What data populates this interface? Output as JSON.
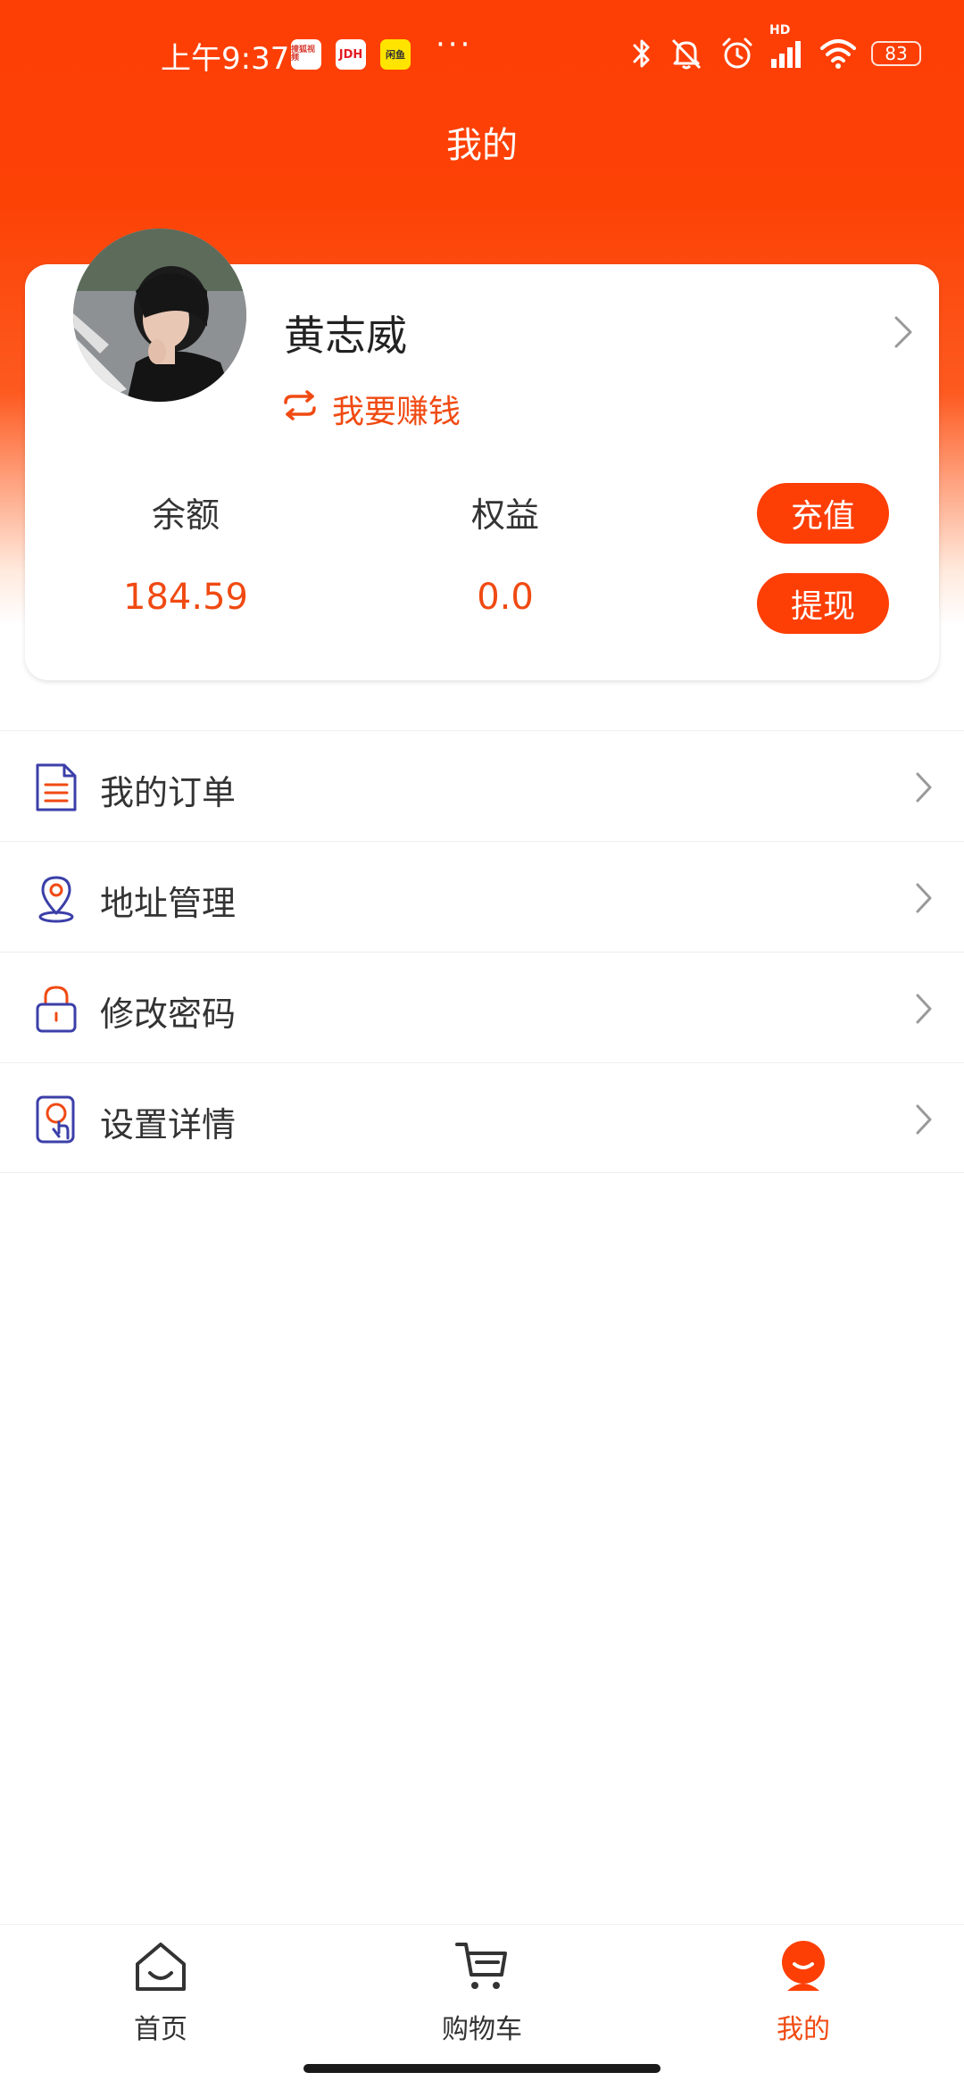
{
  "status_bar": {
    "time": "上午9:37",
    "notification_badges": [
      "搜狐视频",
      "JDH",
      "闲鱼"
    ],
    "more": "···",
    "icons": [
      "bluetooth-icon",
      "mute-icon",
      "alarm-icon",
      "signal-icon",
      "wifi-icon"
    ],
    "signal_label": "HD",
    "battery": "83"
  },
  "header": {
    "title": "我的"
  },
  "profile": {
    "name": "黄志威",
    "earn_link": "我要赚钱",
    "balance_label": "余额",
    "balance_value": "184.59",
    "equity_label": "权益",
    "equity_value": "0.0",
    "recharge_button": "充值",
    "withdraw_button": "提现"
  },
  "menu": {
    "items": [
      {
        "label": "我的订单",
        "icon": "order-document-icon"
      },
      {
        "label": "地址管理",
        "icon": "location-pin-icon"
      },
      {
        "label": "修改密码",
        "icon": "lock-icon"
      },
      {
        "label": "设置详情",
        "icon": "settings-touch-icon"
      }
    ]
  },
  "tab_bar": {
    "tabs": [
      {
        "label": "首页",
        "icon": "home-icon"
      },
      {
        "label": "购物车",
        "icon": "cart-icon"
      },
      {
        "label": "我的",
        "icon": "profile-icon",
        "active": true
      }
    ]
  },
  "colors": {
    "primary": "#fd3e05",
    "accent_text": "#f04a12",
    "icon_blue": "#3b3fa8"
  }
}
